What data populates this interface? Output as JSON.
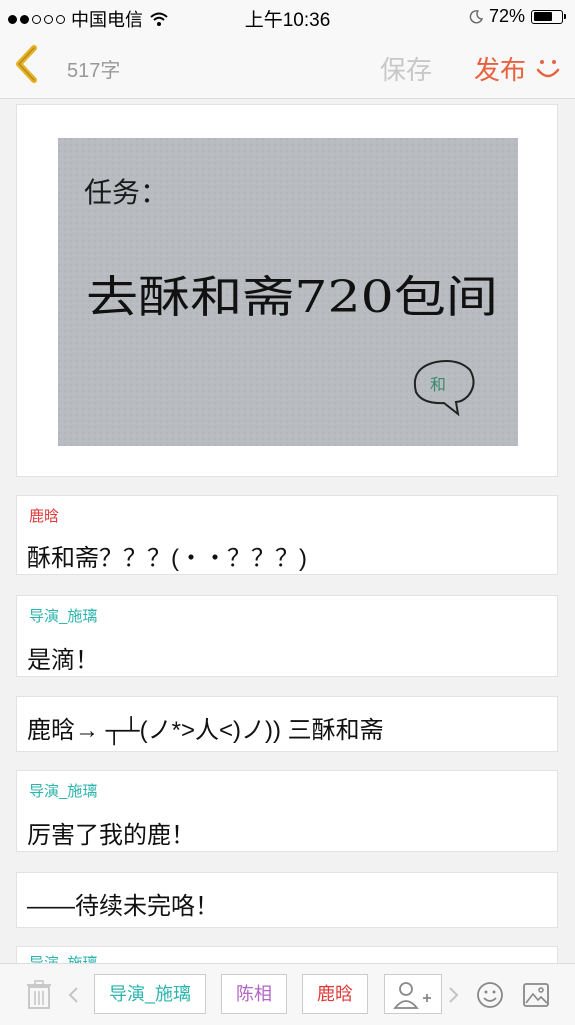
{
  "status_bar": {
    "carrier": "中国电信",
    "time": "上午10:36",
    "battery": "72%",
    "battery_level": 0.72
  },
  "header": {
    "word_count": "517字",
    "save_label": "保存",
    "publish_label": "发布"
  },
  "photo": {
    "line1": "任务：",
    "line2": "去酥和斋720包间",
    "stamp": "和"
  },
  "messages": [
    {
      "speaker": "鹿晗",
      "text": "酥和斋？？？(・・？？？)"
    },
    {
      "speaker": "导演_施璃",
      "text": "是滴！"
    },
    {
      "speaker": "",
      "text": "鹿晗→ ┬┴(ノ*>人<)ノ)) 三酥和斋"
    },
    {
      "speaker": "导演_施璃",
      "text": "厉害了我的鹿！"
    },
    {
      "speaker": "",
      "text": "——待续未完咯！"
    },
    {
      "speaker": "导演_施璃",
      "text": ""
    }
  ],
  "toolbar": {
    "roles": [
      "导演_施璃",
      "陈相",
      "鹿晗"
    ],
    "role_colors": [
      "#2bb5ad",
      "#b066c4",
      "#e03a3a"
    ]
  },
  "colors": {
    "accent": "#e8623f",
    "back_arrow": "#e6b020",
    "teal": "#2bb5ad",
    "red": "#e03a3a",
    "purple": "#b066c4"
  }
}
